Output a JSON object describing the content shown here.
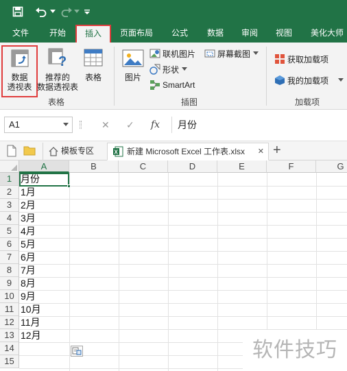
{
  "quick_access": {
    "save_icon": "save-icon",
    "undo_icon": "undo-icon",
    "redo_icon": "redo-icon",
    "customize_icon": "customize-icon"
  },
  "ribbon_tabs": [
    {
      "label": "文件"
    },
    {
      "label": "开始"
    },
    {
      "label": "插入"
    },
    {
      "label": "页面布局"
    },
    {
      "label": "公式"
    },
    {
      "label": "数据"
    },
    {
      "label": "审阅"
    },
    {
      "label": "视图"
    },
    {
      "label": "美化大师"
    }
  ],
  "ribbon": {
    "tables_group": {
      "pivot_table_line1": "数据",
      "pivot_table_line2": "透视表",
      "recommended_line1": "推荐的",
      "recommended_line2": "数据透视表",
      "table": "表格",
      "group_label": "表格"
    },
    "illustrations_group": {
      "picture": "图片",
      "online_picture": "联机图片",
      "shapes": "形状",
      "smartart": "SmartArt",
      "screenshot": "屏幕截图",
      "group_label": "插图"
    },
    "addins_group": {
      "get_addins": "获取加载项",
      "my_addins": "我的加载项",
      "group_label": "加载项"
    }
  },
  "formula_bar": {
    "name_box": "A1",
    "formula": "月份",
    "cancel_symbol": "✕",
    "enter_symbol": "✓",
    "fx_symbol": "fx"
  },
  "doc_tabs": {
    "template_tab": "模板专区",
    "file_tab": "新建 Microsoft Excel 工作表.xlsx",
    "close_symbol": "✕",
    "new_tab_symbol": "+"
  },
  "sheet": {
    "columns": [
      "A",
      "B",
      "C",
      "D",
      "E",
      "F",
      "G"
    ],
    "rows": [
      "1",
      "2",
      "3",
      "4",
      "5",
      "6",
      "7",
      "8",
      "9",
      "10",
      "11",
      "12",
      "13",
      "14",
      "15"
    ],
    "column_a_values": [
      "月份",
      "1月",
      "2月",
      "3月",
      "4月",
      "5月",
      "6月",
      "7月",
      "8月",
      "9月",
      "10月",
      "11月",
      "12月"
    ],
    "active_cell": "A1"
  },
  "watermark": "软件技巧",
  "colors": {
    "excel_green": "#217346",
    "highlight_red": "#e03c3c"
  }
}
